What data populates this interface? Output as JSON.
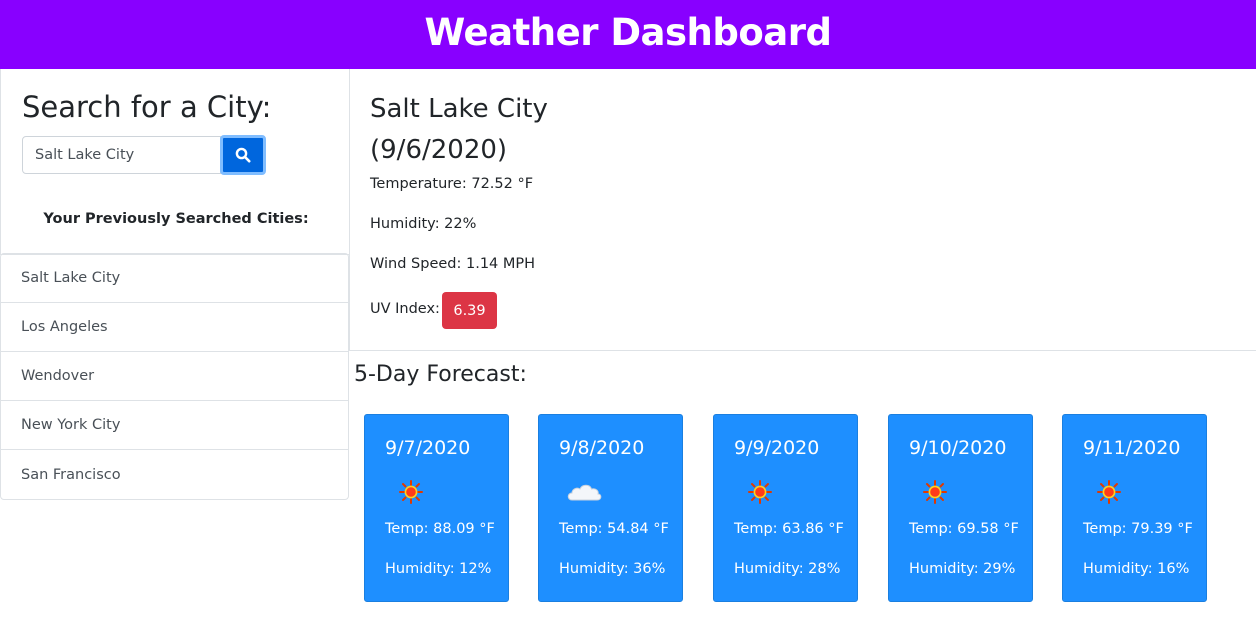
{
  "header": {
    "title": "Weather Dashboard"
  },
  "search": {
    "title": "Search for a City:",
    "input_value": "Salt Lake City",
    "button_icon": "search-icon",
    "previous_label": "Your Previously Searched Cities:"
  },
  "history": [
    {
      "label": "Salt Lake City"
    },
    {
      "label": "Los Angeles"
    },
    {
      "label": "Wendover"
    },
    {
      "label": "New York City"
    },
    {
      "label": "San Francisco"
    }
  ],
  "current": {
    "city": "Salt Lake City",
    "date": "(9/6/2020)",
    "temperature": "Temperature: 72.52 °F",
    "humidity": "Humidity: 22%",
    "wind": "Wind Speed: 1.14 MPH",
    "uv_label": "UV Index:",
    "uv_value": "6.39",
    "uv_color": "#dc3545"
  },
  "forecast": {
    "title": "5-Day Forecast:",
    "card_color": "#1e8fff",
    "days": [
      {
        "date": "9/7/2020",
        "icon": "sun-icon",
        "temp": "Temp: 88.09 °F",
        "humidity": "Humidity: 12%"
      },
      {
        "date": "9/8/2020",
        "icon": "cloud-icon",
        "temp": "Temp: 54.84 °F",
        "humidity": "Humidity: 36%"
      },
      {
        "date": "9/9/2020",
        "icon": "sun-icon",
        "temp": "Temp: 63.86 °F",
        "humidity": "Humidity: 28%"
      },
      {
        "date": "9/10/2020",
        "icon": "sun-icon",
        "temp": "Temp: 69.58 °F",
        "humidity": "Humidity: 29%"
      },
      {
        "date": "9/11/2020",
        "icon": "sun-icon",
        "temp": "Temp: 79.39 °F",
        "humidity": "Humidity: 16%"
      }
    ]
  },
  "colors": {
    "header": "#8800ff",
    "search_button": "#0066dd"
  }
}
